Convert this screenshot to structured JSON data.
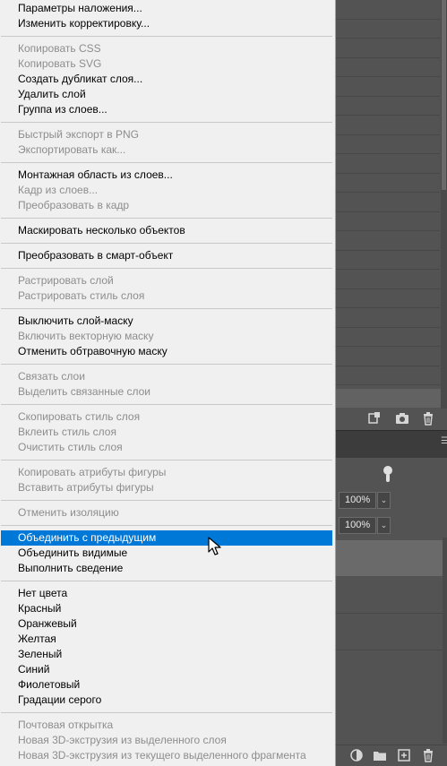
{
  "context_menu": {
    "items": [
      {
        "label": "Параметры наложения...",
        "enabled": true
      },
      {
        "label": "Изменить корректировку...",
        "enabled": true
      },
      {
        "label": "Копировать CSS",
        "enabled": false
      },
      {
        "label": "Копировать SVG",
        "enabled": false
      },
      {
        "label": "Создать дубликат слоя...",
        "enabled": true
      },
      {
        "label": "Удалить слой",
        "enabled": true
      },
      {
        "label": "Группа из слоев...",
        "enabled": true
      },
      {
        "label": "Быстрый экспорт в PNG",
        "enabled": false
      },
      {
        "label": "Экспортировать как...",
        "enabled": false
      },
      {
        "label": "Монтажная область из слоев...",
        "enabled": true
      },
      {
        "label": "Кадр из слоев...",
        "enabled": false
      },
      {
        "label": "Преобразовать в кадр",
        "enabled": false
      },
      {
        "label": "Маскировать несколько объектов",
        "enabled": true
      },
      {
        "label": "Преобразовать в смарт-объект",
        "enabled": true
      },
      {
        "label": "Растрировать слой",
        "enabled": false
      },
      {
        "label": "Растрировать стиль слоя",
        "enabled": false
      },
      {
        "label": "Выключить слой-маску",
        "enabled": true
      },
      {
        "label": "Включить векторную маску",
        "enabled": false
      },
      {
        "label": "Отменить обтравочную маску",
        "enabled": true
      },
      {
        "label": "Связать слои",
        "enabled": false
      },
      {
        "label": "Выделить связанные слои",
        "enabled": false
      },
      {
        "label": "Скопировать стиль слоя",
        "enabled": false
      },
      {
        "label": "Вклеить стиль слоя",
        "enabled": false
      },
      {
        "label": "Очистить стиль слоя",
        "enabled": false
      },
      {
        "label": "Копировать атрибуты фигуры",
        "enabled": false
      },
      {
        "label": "Вставить атрибуты фигуры",
        "enabled": false
      },
      {
        "label": "Отменить изоляцию",
        "enabled": false
      },
      {
        "label": "Объединить с предыдущим",
        "enabled": true,
        "highlighted": true
      },
      {
        "label": "Объединить видимые",
        "enabled": true
      },
      {
        "label": "Выполнить сведение",
        "enabled": true
      },
      {
        "label": "Нет цвета",
        "enabled": true
      },
      {
        "label": "Красный",
        "enabled": true
      },
      {
        "label": "Оранжевый",
        "enabled": true
      },
      {
        "label": "Желтая",
        "enabled": true
      },
      {
        "label": "Зеленый",
        "enabled": true
      },
      {
        "label": "Синий",
        "enabled": true
      },
      {
        "label": "Фиолетовый",
        "enabled": true
      },
      {
        "label": "Градации серого",
        "enabled": true
      },
      {
        "label": "Почтовая открытка",
        "enabled": false
      },
      {
        "label": "Новая 3D-экструзия из выделенного слоя",
        "enabled": false
      },
      {
        "label": "Новая 3D-экструзия из текущего выделенного фрагмента",
        "enabled": false
      }
    ]
  },
  "layers_panel": {
    "opacity_value": "100%",
    "fill_value": "100%"
  },
  "colors": {
    "menu_background": "#f0f0f0",
    "highlight": "#0078d7",
    "disabled_text": "#8d8d8d",
    "panel_background": "#535353"
  },
  "icons": {
    "upper_toolbar": [
      "new-layer-from-selection-icon",
      "camera-icon",
      "trash-icon"
    ],
    "bottom_toolbar": [
      "adjustment-layer-icon",
      "folder-icon",
      "new-layer-icon",
      "trash-icon"
    ],
    "cursor": "arrow-cursor-icon"
  }
}
